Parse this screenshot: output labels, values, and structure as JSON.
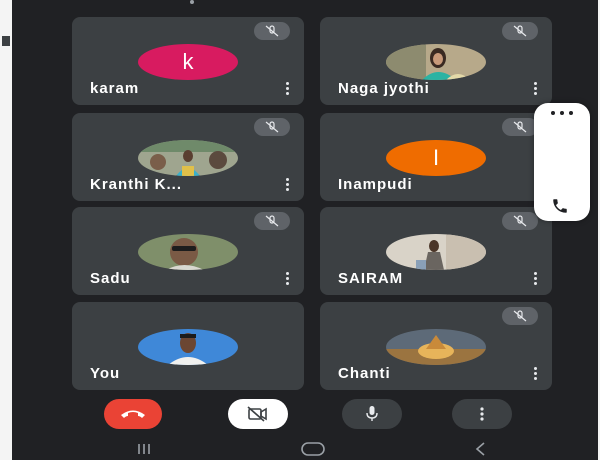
{
  "participants": [
    {
      "name": "karam",
      "avatar_letter": "k",
      "avatar_color": "#d81b60",
      "muted": true
    },
    {
      "name": "Naga jyothi",
      "avatar_type": "photo",
      "muted": true
    },
    {
      "name": "Kranthi K...",
      "avatar_type": "photo",
      "muted": true
    },
    {
      "name": "Inampudi",
      "avatar_letter": "I",
      "avatar_color": "#ef6c00",
      "muted": true
    },
    {
      "name": "Sadu",
      "avatar_type": "photo",
      "muted": true
    },
    {
      "name": "SAIRAM",
      "avatar_type": "photo",
      "muted": true
    },
    {
      "name": "You",
      "avatar_type": "photo",
      "muted": false
    },
    {
      "name": "Chanti",
      "avatar_type": "photo",
      "muted": true
    }
  ],
  "controls": {
    "end_call_icon": "phone-hangup-icon",
    "camera_icon": "camera-off-icon",
    "mic_icon": "microphone-icon",
    "more_icon": "more-vertical-icon"
  },
  "floating_panel": {
    "icons": [
      "more-horizontal-icon",
      "phone-icon"
    ]
  },
  "nav_bar": {
    "buttons": [
      "recents-icon",
      "home-icon",
      "back-icon"
    ]
  },
  "colors": {
    "background": "#202124",
    "tile": "#3c4043",
    "end_call": "#ea4335",
    "text": "#ffffff"
  }
}
